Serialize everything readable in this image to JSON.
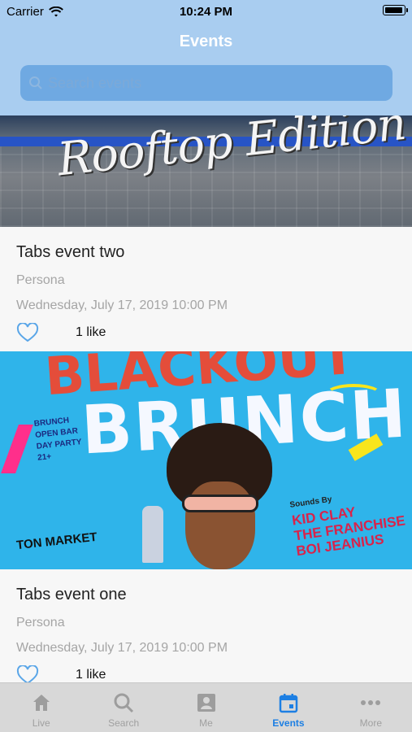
{
  "status_bar": {
    "carrier": "Carrier",
    "time": "10:24 PM"
  },
  "header": {
    "title": "Events"
  },
  "search": {
    "placeholder": "Search events",
    "value": ""
  },
  "events": [
    {
      "image_text": "Rooftop Edition",
      "title": "Tabs event two",
      "organizer": "Persona",
      "date": "Wednesday, July 17, 2019 10:00 PM",
      "likes": "1 like"
    },
    {
      "image_text": "BRUNCH",
      "image_top_text": "BLACKOUT",
      "image_left_text": [
        "BRUNCH",
        "OPEN BAR",
        "DAY PARTY",
        "21+"
      ],
      "image_right_text": [
        "Sounds By",
        "KID CLAY",
        "THE FRANCHISE",
        "BOI JEANIUS"
      ],
      "image_bottom_text": "TON MARKET",
      "title": "Tabs event one",
      "organizer": "Persona",
      "date": "Wednesday, July 17, 2019 10:00 PM",
      "likes": "1 like"
    }
  ],
  "tabbar": {
    "tabs": [
      {
        "label": "Live",
        "icon": "home-icon"
      },
      {
        "label": "Search",
        "icon": "search-icon"
      },
      {
        "label": "Me",
        "icon": "contact-card-icon"
      },
      {
        "label": "Events",
        "icon": "calendar-icon",
        "active": true
      },
      {
        "label": "More",
        "icon": "more-dots-icon"
      }
    ]
  },
  "colors": {
    "header_bg": "#a9cdf0",
    "search_bg": "#6fa9e2",
    "active_tab": "#1d7fe3",
    "tabbar_bg": "#d8d8d8"
  }
}
